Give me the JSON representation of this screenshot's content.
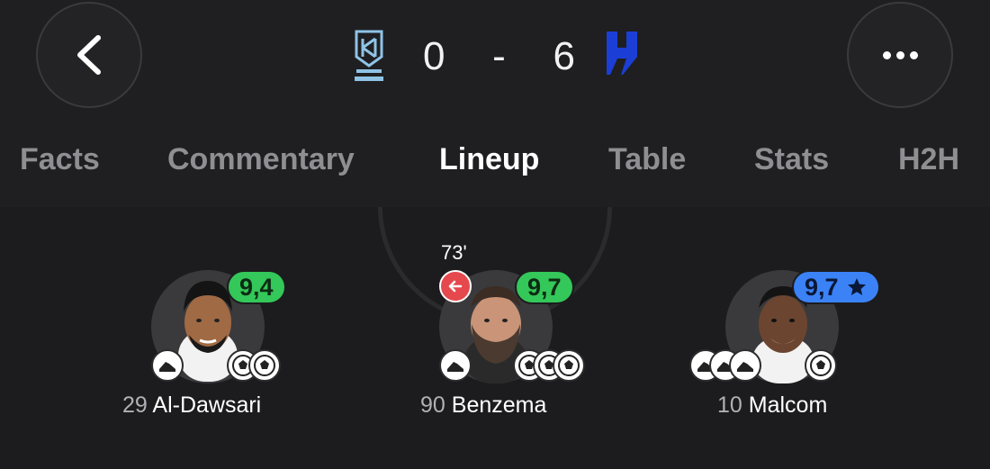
{
  "match": {
    "home_team_logo": "al-akhdoud-logo",
    "away_team_logo": "al-hilal-logo",
    "score_home": "0",
    "score_separator": "-",
    "score_away": "6"
  },
  "header": {
    "back_icon": "chevron-left-icon",
    "more_icon": "more-horizontal-icon"
  },
  "tabs": [
    {
      "label": "Facts"
    },
    {
      "label": "Commentary"
    },
    {
      "label": "Lineup"
    },
    {
      "label": "Table"
    },
    {
      "label": "Stats"
    },
    {
      "label": "H2H"
    }
  ],
  "active_tab": "Lineup",
  "colors": {
    "rating_green": "#34c759",
    "rating_blue": "#3b82f6",
    "sub_out_red": "#e5484d",
    "home_logo": "#8fc3e6",
    "away_logo": "#1b3fd6"
  },
  "players": [
    {
      "number": "29",
      "name": "Al-Dawsari",
      "rating": "9,4",
      "rating_color": "green"
    },
    {
      "number": "90",
      "name": "Benzema",
      "rating": "9,7",
      "rating_color": "green",
      "sub_time": "73'"
    },
    {
      "number": "10",
      "name": "Malcom",
      "rating": "9,7",
      "rating_color": "blue",
      "player_of_match": "star-icon"
    }
  ]
}
